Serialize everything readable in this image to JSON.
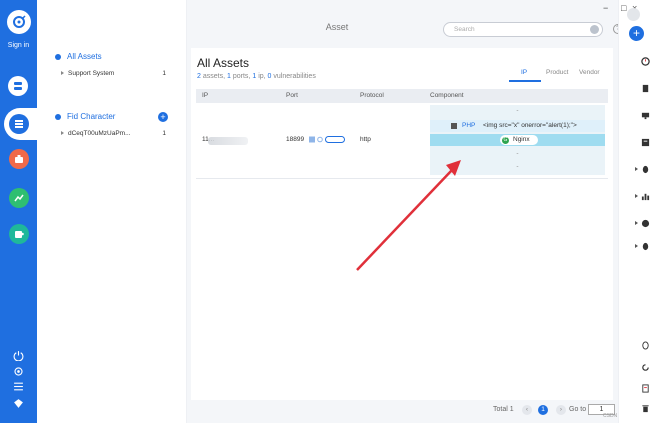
{
  "window": {
    "title": "Asset"
  },
  "leftbar": {
    "signin_label": "Sign in"
  },
  "search": {
    "placeholder": "Search"
  },
  "panel": {
    "sections": [
      {
        "title": "All Assets",
        "items": [
          {
            "label": "Support System",
            "count": "1"
          }
        ]
      },
      {
        "title": "Fid Character",
        "items": [
          {
            "label": "dCeqT00uMzUaPm...",
            "count": "1"
          }
        ]
      }
    ]
  },
  "main": {
    "title": "All Assets",
    "summary": {
      "assets": "2",
      "ports": "1",
      "ip": "1",
      "vulns": "0",
      "assets_label": "assets,",
      "ports_label": "ports,",
      "ip_label": "ip,",
      "vulns_label": "vulnerabilities"
    },
    "tabs": [
      "IP",
      "Product",
      "Vendor"
    ],
    "active_tab": "IP",
    "table": {
      "headers": [
        "IP",
        "Port",
        "Protocol",
        "Component"
      ],
      "rows": [
        {
          "ip": "11...",
          "port": "18899",
          "protocol": "http",
          "components": [
            "-",
            "PHP",
            "<img src=\"x\" onerror=\"alert(1);\">",
            "Nginx",
            "-",
            "-"
          ]
        }
      ]
    }
  },
  "pagination": {
    "total_label": "Total 1",
    "current_page": "1",
    "goto_label": "Go to",
    "goto_value": "1"
  },
  "watermark": "CSDN @Sk...",
  "colors": {
    "accent": "#1f6fe0",
    "sidebar": "#1f6fe0",
    "nginx_bg": "#9fdcf0",
    "arrow": "#e0303a"
  },
  "icons": {
    "sidebar": [
      "satellite-icon",
      "server-icon",
      "list-icon",
      "briefcase-icon",
      "chart-icon",
      "puzzle-icon",
      "power-icon",
      "settings-icon",
      "menu-icon",
      "diamond-icon"
    ],
    "rightbar": [
      "qr-icon",
      "add-icon",
      "clock-icon",
      "document-icon",
      "monitor-icon",
      "id-icon",
      "bug-icon",
      "bar-chart-icon",
      "fingerprint-icon",
      "bug-icon",
      "refresh-icon",
      "note-icon",
      "trash-icon"
    ]
  }
}
